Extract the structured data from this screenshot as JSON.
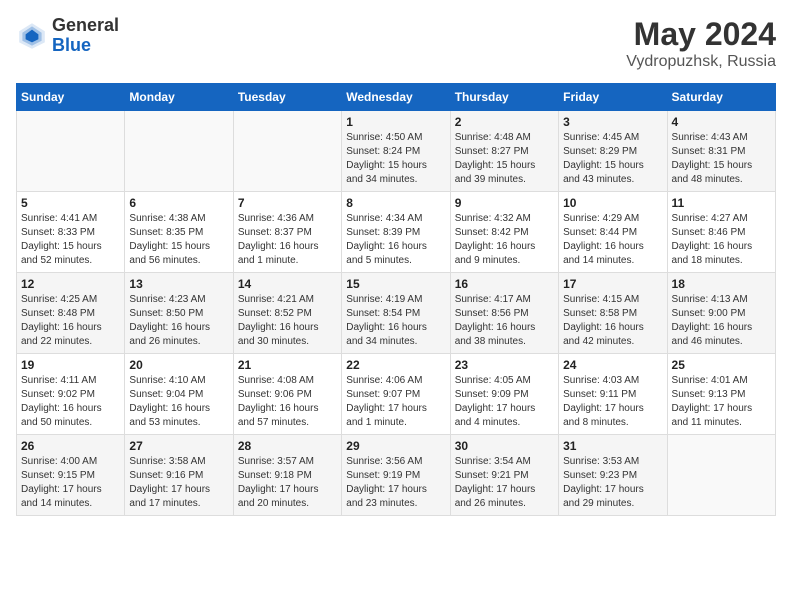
{
  "header": {
    "logo_general": "General",
    "logo_blue": "Blue",
    "title": "May 2024",
    "location": "Vydropuzhsk, Russia"
  },
  "days_of_week": [
    "Sunday",
    "Monday",
    "Tuesday",
    "Wednesday",
    "Thursday",
    "Friday",
    "Saturday"
  ],
  "weeks": [
    [
      {
        "day": "",
        "sunrise": "",
        "sunset": "",
        "daylight": ""
      },
      {
        "day": "",
        "sunrise": "",
        "sunset": "",
        "daylight": ""
      },
      {
        "day": "",
        "sunrise": "",
        "sunset": "",
        "daylight": ""
      },
      {
        "day": "1",
        "sunrise": "Sunrise: 4:50 AM",
        "sunset": "Sunset: 8:24 PM",
        "daylight": "Daylight: 15 hours and 34 minutes."
      },
      {
        "day": "2",
        "sunrise": "Sunrise: 4:48 AM",
        "sunset": "Sunset: 8:27 PM",
        "daylight": "Daylight: 15 hours and 39 minutes."
      },
      {
        "day": "3",
        "sunrise": "Sunrise: 4:45 AM",
        "sunset": "Sunset: 8:29 PM",
        "daylight": "Daylight: 15 hours and 43 minutes."
      },
      {
        "day": "4",
        "sunrise": "Sunrise: 4:43 AM",
        "sunset": "Sunset: 8:31 PM",
        "daylight": "Daylight: 15 hours and 48 minutes."
      }
    ],
    [
      {
        "day": "5",
        "sunrise": "Sunrise: 4:41 AM",
        "sunset": "Sunset: 8:33 PM",
        "daylight": "Daylight: 15 hours and 52 minutes."
      },
      {
        "day": "6",
        "sunrise": "Sunrise: 4:38 AM",
        "sunset": "Sunset: 8:35 PM",
        "daylight": "Daylight: 15 hours and 56 minutes."
      },
      {
        "day": "7",
        "sunrise": "Sunrise: 4:36 AM",
        "sunset": "Sunset: 8:37 PM",
        "daylight": "Daylight: 16 hours and 1 minute."
      },
      {
        "day": "8",
        "sunrise": "Sunrise: 4:34 AM",
        "sunset": "Sunset: 8:39 PM",
        "daylight": "Daylight: 16 hours and 5 minutes."
      },
      {
        "day": "9",
        "sunrise": "Sunrise: 4:32 AM",
        "sunset": "Sunset: 8:42 PM",
        "daylight": "Daylight: 16 hours and 9 minutes."
      },
      {
        "day": "10",
        "sunrise": "Sunrise: 4:29 AM",
        "sunset": "Sunset: 8:44 PM",
        "daylight": "Daylight: 16 hours and 14 minutes."
      },
      {
        "day": "11",
        "sunrise": "Sunrise: 4:27 AM",
        "sunset": "Sunset: 8:46 PM",
        "daylight": "Daylight: 16 hours and 18 minutes."
      }
    ],
    [
      {
        "day": "12",
        "sunrise": "Sunrise: 4:25 AM",
        "sunset": "Sunset: 8:48 PM",
        "daylight": "Daylight: 16 hours and 22 minutes."
      },
      {
        "day": "13",
        "sunrise": "Sunrise: 4:23 AM",
        "sunset": "Sunset: 8:50 PM",
        "daylight": "Daylight: 16 hours and 26 minutes."
      },
      {
        "day": "14",
        "sunrise": "Sunrise: 4:21 AM",
        "sunset": "Sunset: 8:52 PM",
        "daylight": "Daylight: 16 hours and 30 minutes."
      },
      {
        "day": "15",
        "sunrise": "Sunrise: 4:19 AM",
        "sunset": "Sunset: 8:54 PM",
        "daylight": "Daylight: 16 hours and 34 minutes."
      },
      {
        "day": "16",
        "sunrise": "Sunrise: 4:17 AM",
        "sunset": "Sunset: 8:56 PM",
        "daylight": "Daylight: 16 hours and 38 minutes."
      },
      {
        "day": "17",
        "sunrise": "Sunrise: 4:15 AM",
        "sunset": "Sunset: 8:58 PM",
        "daylight": "Daylight: 16 hours and 42 minutes."
      },
      {
        "day": "18",
        "sunrise": "Sunrise: 4:13 AM",
        "sunset": "Sunset: 9:00 PM",
        "daylight": "Daylight: 16 hours and 46 minutes."
      }
    ],
    [
      {
        "day": "19",
        "sunrise": "Sunrise: 4:11 AM",
        "sunset": "Sunset: 9:02 PM",
        "daylight": "Daylight: 16 hours and 50 minutes."
      },
      {
        "day": "20",
        "sunrise": "Sunrise: 4:10 AM",
        "sunset": "Sunset: 9:04 PM",
        "daylight": "Daylight: 16 hours and 53 minutes."
      },
      {
        "day": "21",
        "sunrise": "Sunrise: 4:08 AM",
        "sunset": "Sunset: 9:06 PM",
        "daylight": "Daylight: 16 hours and 57 minutes."
      },
      {
        "day": "22",
        "sunrise": "Sunrise: 4:06 AM",
        "sunset": "Sunset: 9:07 PM",
        "daylight": "Daylight: 17 hours and 1 minute."
      },
      {
        "day": "23",
        "sunrise": "Sunrise: 4:05 AM",
        "sunset": "Sunset: 9:09 PM",
        "daylight": "Daylight: 17 hours and 4 minutes."
      },
      {
        "day": "24",
        "sunrise": "Sunrise: 4:03 AM",
        "sunset": "Sunset: 9:11 PM",
        "daylight": "Daylight: 17 hours and 8 minutes."
      },
      {
        "day": "25",
        "sunrise": "Sunrise: 4:01 AM",
        "sunset": "Sunset: 9:13 PM",
        "daylight": "Daylight: 17 hours and 11 minutes."
      }
    ],
    [
      {
        "day": "26",
        "sunrise": "Sunrise: 4:00 AM",
        "sunset": "Sunset: 9:15 PM",
        "daylight": "Daylight: 17 hours and 14 minutes."
      },
      {
        "day": "27",
        "sunrise": "Sunrise: 3:58 AM",
        "sunset": "Sunset: 9:16 PM",
        "daylight": "Daylight: 17 hours and 17 minutes."
      },
      {
        "day": "28",
        "sunrise": "Sunrise: 3:57 AM",
        "sunset": "Sunset: 9:18 PM",
        "daylight": "Daylight: 17 hours and 20 minutes."
      },
      {
        "day": "29",
        "sunrise": "Sunrise: 3:56 AM",
        "sunset": "Sunset: 9:19 PM",
        "daylight": "Daylight: 17 hours and 23 minutes."
      },
      {
        "day": "30",
        "sunrise": "Sunrise: 3:54 AM",
        "sunset": "Sunset: 9:21 PM",
        "daylight": "Daylight: 17 hours and 26 minutes."
      },
      {
        "day": "31",
        "sunrise": "Sunrise: 3:53 AM",
        "sunset": "Sunset: 9:23 PM",
        "daylight": "Daylight: 17 hours and 29 minutes."
      },
      {
        "day": "",
        "sunrise": "",
        "sunset": "",
        "daylight": ""
      }
    ]
  ]
}
